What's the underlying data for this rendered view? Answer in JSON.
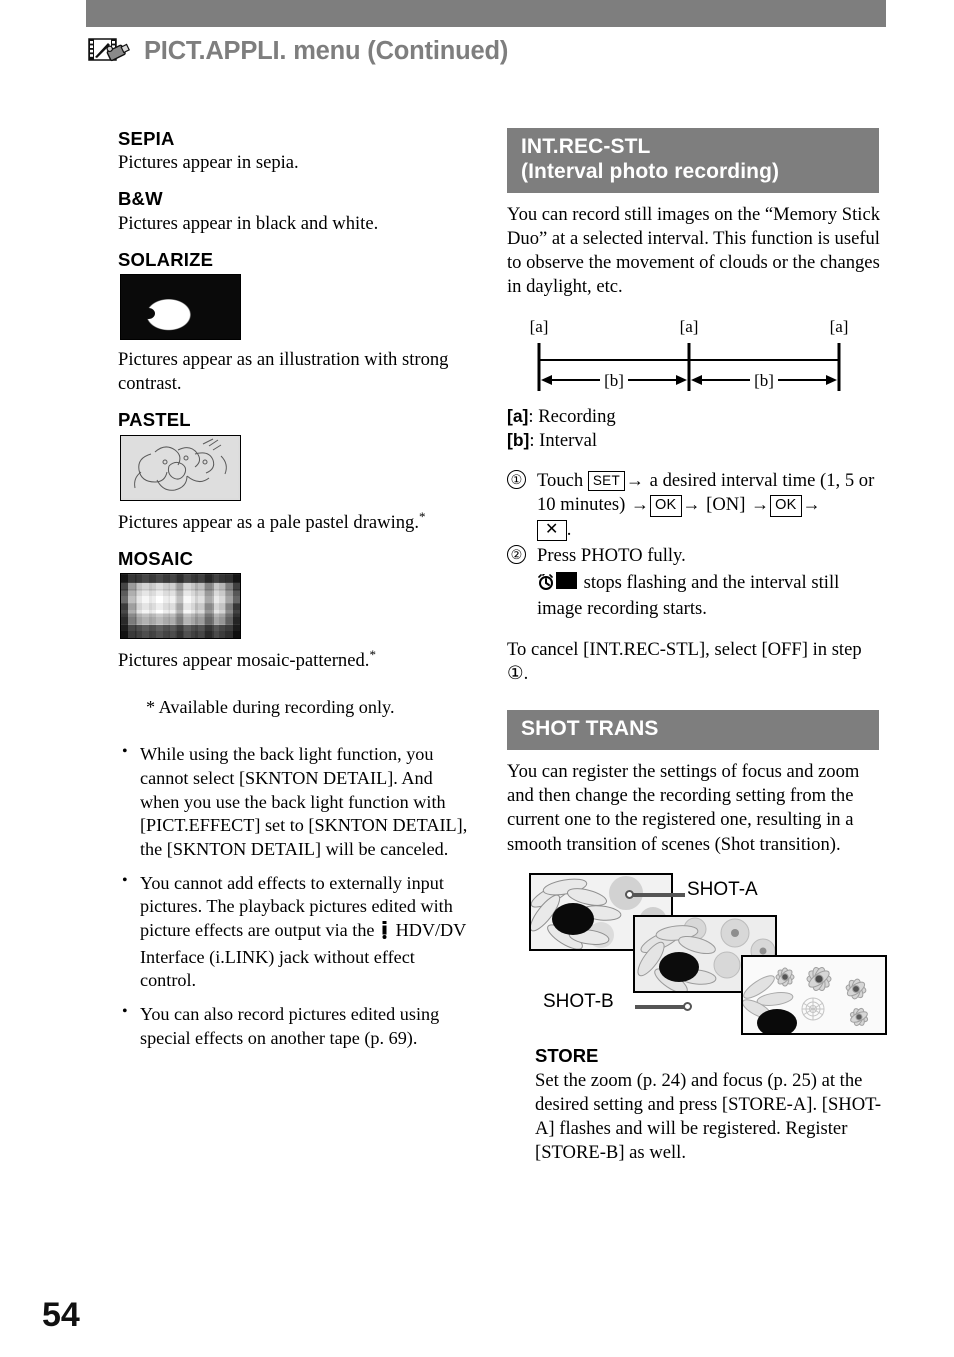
{
  "header": {
    "icon": "film-camcorder-icon",
    "title": "PICT.APPLI. menu (Continued)",
    "bar_color": "#7e7e7e"
  },
  "page_number": "54",
  "left_column": {
    "effects": [
      {
        "name": "SEPIA",
        "caption": "Pictures appear in sepia.",
        "thumbnail": null
      },
      {
        "name": "B&W",
        "caption": "Pictures appear in black and white.",
        "thumbnail": null
      },
      {
        "name": "SOLARIZE",
        "caption": "Pictures appear as an illustration with strong contrast.",
        "thumbnail": "solarize-sample-image"
      },
      {
        "name": "PASTEL",
        "caption": "Pictures appear as a pale pastel drawing.",
        "caption_footnote": "*",
        "thumbnail": "pastel-sample-image"
      },
      {
        "name": "MOSAIC",
        "caption": "Pictures appear mosaic-patterned.",
        "caption_footnote": "*",
        "thumbnail": "mosaic-sample-image"
      }
    ],
    "footnote": "* Available during recording only.",
    "notes": [
      "While using the back light function, you cannot select [SKNTON DETAIL]. And when you use the back light function with [PICT.EFFECT] set to [SKNTON DETAIL], the [SKNTON DETAIL] will be canceled.",
      "You cannot add effects to externally input pictures. The playback pictures edited with picture effects are output via the ",
      "You can also record pictures edited using special effects on another tape (p. 69)."
    ],
    "note2_tail": " HDV/DV Interface (i.LINK) jack without effect control."
  },
  "right_column": {
    "int_rec": {
      "title_line1": "INT.REC-STL",
      "title_line2": "(Interval photo recording)",
      "intro": "You can record still images on the “Memory Stick Duo” at a selected interval. This function is useful to observe the movement of clouds or the changes in daylight, etc.",
      "diagram": {
        "tick_label": "[a]",
        "span_label": "[b]",
        "tick_count": 3,
        "span_count": 2
      },
      "legend": [
        {
          "key": "[a]",
          "text": ": Recording"
        },
        {
          "key": "[b]",
          "text": ": Interval"
        }
      ],
      "steps": [
        {
          "number": "①",
          "parts": [
            {
              "type": "text",
              "value": "Touch "
            },
            {
              "type": "key",
              "value": "SET"
            },
            {
              "type": "arrow",
              "value": "→"
            },
            {
              "type": "text",
              "value": " a desired interval time (1, 5 or 10 minutes) "
            },
            {
              "type": "arrow",
              "value": "→"
            },
            {
              "type": "key",
              "value": "OK"
            },
            {
              "type": "arrow",
              "value": "→"
            },
            {
              "type": "text",
              "value": " [ON] "
            },
            {
              "type": "arrow",
              "value": "→"
            },
            {
              "type": "key",
              "value": "OK"
            },
            {
              "type": "arrow",
              "value": "→"
            },
            {
              "type": "key",
              "value": "✕"
            },
            {
              "type": "text",
              "value": "."
            }
          ]
        },
        {
          "number": "②",
          "text": "Press PHOTO fully.",
          "sub_prefix_icon": "interval-still-flash-icon",
          "sub": " stops flashing and the interval still image recording starts."
        }
      ],
      "cancel_note_part1": "To cancel [INT.REC-STL], select [OFF] in step ",
      "cancel_note_step": "①",
      "cancel_note_part2": "."
    },
    "shot_trans": {
      "title": "SHOT TRANS",
      "intro": "You can register the settings of focus and zoom and then change the recording setting from the current one to the registered one, resulting in a smooth transition of scenes (Shot transition).",
      "figure": {
        "label_a": "SHOT-A",
        "label_b": "SHOT-B",
        "images": [
          "shot-a-sample-image",
          "shot-middle-sample-image",
          "shot-b-sample-image"
        ]
      },
      "store": {
        "title": "STORE",
        "text": "Set the zoom (p. 24) and focus (p. 25) at the desired setting and press [STORE-A]. [SHOT-A] flashes and will be registered. Register [STORE-B] as well."
      }
    }
  }
}
